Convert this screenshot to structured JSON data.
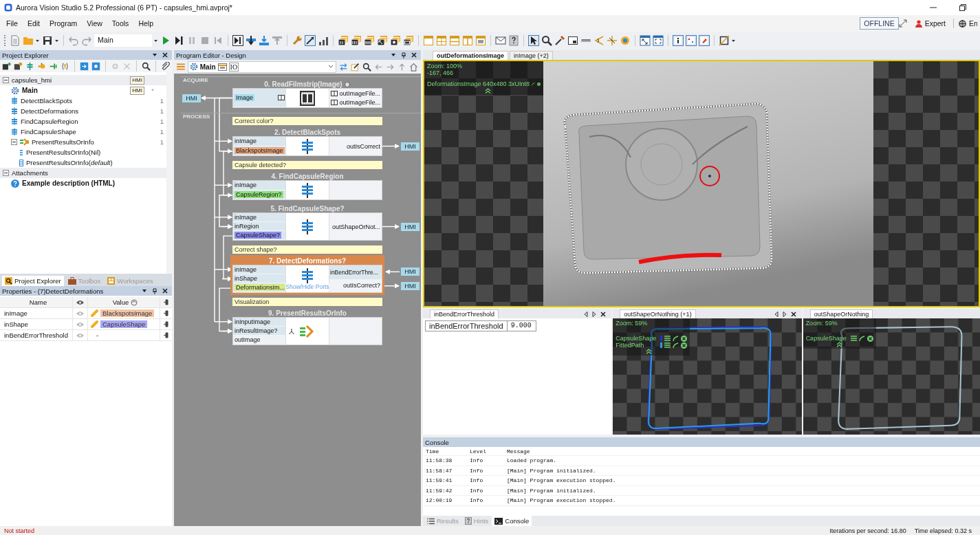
{
  "window": {
    "title": "Aurora Vision Studio 5.2 Professional (6 PT) - capsules_hmi.avproj*"
  },
  "menu": [
    "File",
    "Edit",
    "Program",
    "View",
    "Tools",
    "Help"
  ],
  "header_right": {
    "mode_button": "OFFLINE",
    "user": "Expert",
    "language": "En"
  },
  "toolbar": {
    "program_select": "Main"
  },
  "project_explorer": {
    "title": "Project Explorer",
    "tree": [
      {
        "label": "capsules_hmi",
        "expanded": true,
        "badge": "HMI",
        "children": [
          {
            "label": "Main",
            "kind": "main",
            "badge": "HMI",
            "mark": "*"
          },
          {
            "label": "DetectBlackSpots",
            "kind": "macro",
            "count": "1"
          },
          {
            "label": "DetectDeformations",
            "kind": "macro",
            "count": "1"
          },
          {
            "label": "FindCapsuleRegion",
            "kind": "macro",
            "count": "1"
          },
          {
            "label": "FindCapsuleShape",
            "kind": "macro",
            "count": "1"
          },
          {
            "label": "PresentResultsOrInfo",
            "kind": "variant",
            "count": "1",
            "expanded": true,
            "children": [
              {
                "label": "PresentResultsOrInfo(Nil)",
                "kind": "case-nil"
              },
              {
                "label": "PresentResultsOrInfo(*default*)",
                "kind": "case-default"
              }
            ]
          }
        ]
      },
      {
        "label": "Attachments",
        "expanded": true,
        "children": [
          {
            "label": "Example description (HTML)",
            "kind": "attachment"
          }
        ]
      }
    ]
  },
  "left_tabs": [
    {
      "label": "Project Explorer",
      "selected": true
    },
    {
      "label": "Toolbox",
      "selected": false
    },
    {
      "label": "Workspaces",
      "selected": false
    }
  ],
  "properties": {
    "title": "Properties - (7)DetectDeformations",
    "columns": {
      "name": "Name",
      "value": "Value"
    },
    "rows": [
      {
        "name": "inImage",
        "value": "BlackspotsImage",
        "color": "#f2c4a6"
      },
      {
        "name": "inShape",
        "value": "CapsuleShape",
        "color": "#aaa8f2"
      },
      {
        "name": "inBendErrorThreshold",
        "value": "-"
      }
    ]
  },
  "program_editor": {
    "title": "Program Editor - Design",
    "path": "Main",
    "io": "IO",
    "items": [
      {
        "kind": "section",
        "label": "ACQUIRE"
      },
      {
        "kind": "filmstrip",
        "title": "0. ReadFilmstrip(Image)",
        "selected": false,
        "hmi_in": "HMI",
        "inputs": [
          {
            "label": "Image",
            "kind": "tag",
            "color": "#a6dcea"
          }
        ],
        "outputs": [
          {
            "label": "outImageFile...",
            "kind": "output"
          },
          {
            "label": "outImageFile...",
            "kind": "output"
          }
        ]
      },
      {
        "kind": "section",
        "label": "PROCESS"
      },
      {
        "kind": "comment",
        "label": "Correct color?"
      },
      {
        "kind": "macro",
        "title": "2. DetectBlackSpots",
        "selected": false,
        "inputs": [
          {
            "label": "inImage",
            "kind": "port"
          },
          {
            "label": "BlackspotsImage",
            "kind": "tag",
            "color": "#e8a882"
          }
        ],
        "outputs": [
          {
            "label": "outIsCorrect",
            "kind": "output",
            "hmi": "HMI"
          }
        ]
      },
      {
        "kind": "comment",
        "label": "Capsule detected?"
      },
      {
        "kind": "macro",
        "title": "4. FindCapsuleRegion",
        "selected": false,
        "inputs": [
          {
            "label": "inImage",
            "kind": "port"
          },
          {
            "label": "CapsuleRegion?",
            "kind": "tag",
            "color": "#8ee07a"
          }
        ]
      },
      {
        "kind": "macro",
        "title": "5. FindCapsuleShape?",
        "selected": false,
        "inputs": [
          {
            "label": "inImage",
            "kind": "port"
          },
          {
            "label": "inRegion",
            "kind": "port"
          },
          {
            "label": "CapsuleShape?",
            "kind": "tag",
            "color": "#8f8cf0"
          }
        ],
        "outputs": [
          {
            "label": "outShapeOrNot...",
            "kind": "output",
            "hmi": "HMI"
          }
        ]
      },
      {
        "kind": "comment",
        "label": "Correct shape?"
      },
      {
        "kind": "macro",
        "title": "7. DetectDeformations?",
        "selected": true,
        "center_label": "Show/Hide Ports",
        "inputs": [
          {
            "label": "inImage",
            "kind": "port"
          },
          {
            "label": "inShape",
            "kind": "port"
          },
          {
            "label": "DeformationsIm...",
            "kind": "tag",
            "color": "#d6ea8a"
          }
        ],
        "outputs": [
          {
            "label": "inBendErrorThre...",
            "kind": "input",
            "hmi": "HMI"
          },
          {
            "label": "outIsCorrect?",
            "kind": "output",
            "hmi": "HMI"
          }
        ]
      },
      {
        "kind": "comment",
        "label": "Visualization"
      },
      {
        "kind": "variant",
        "title": "9. PresentResultsOrInfo",
        "selected": false,
        "inputs": [
          {
            "label": "inInputImage",
            "kind": "port"
          },
          {
            "label": "inResultImage?",
            "kind": "port"
          },
          {
            "label": "outImage",
            "kind": "output"
          }
        ]
      }
    ]
  },
  "image_view": {
    "tabs": [
      {
        "label": "outDeformationsImage",
        "selected": true
      },
      {
        "label": "inImage (+2)",
        "selected": false
      }
    ],
    "zoom": "Zoom: 100%",
    "coords": "-167, 466",
    "layer": "DeformationsImage 640x480 3xUInt8"
  },
  "bottom_panels": [
    {
      "kind": "parameter",
      "tab": "inBendErrorThreshold",
      "closable": true,
      "name": "inBendErrorThreshold",
      "value": "9.000"
    },
    {
      "kind": "shape",
      "tab": "outShapeOrNothing (+1)",
      "closable": true,
      "zoom": "Zoom: 59%",
      "layers": [
        {
          "label": "CapsuleShape",
          "color": "#2a2fd0"
        },
        {
          "label": "FittedPath",
          "color": "#2a9be0"
        }
      ]
    },
    {
      "kind": "shape",
      "tab": "outShapeOrNothing",
      "closable": false,
      "zoom": "Zoom: 59%",
      "layers": [
        {
          "label": "CapsuleShape"
        }
      ]
    }
  ],
  "console": {
    "title": "Console",
    "columns": [
      "Time",
      "Level",
      "Message"
    ],
    "rows": [
      {
        "time": "11:58:38",
        "level": "Info",
        "message": "Loaded program."
      },
      {
        "time": "11:58:47",
        "level": "Info",
        "message": "[Main] Program initialized."
      },
      {
        "time": "11:59:41",
        "level": "Info",
        "message": "[Main] Program execution stopped."
      },
      {
        "time": "11:59:42",
        "level": "Info",
        "message": "[Main] Program initialized."
      },
      {
        "time": "12:00:19",
        "level": "Info",
        "message": "[Main] Program execution stopped."
      }
    ]
  },
  "bottom_tabs": [
    {
      "label": "Results",
      "selected": false
    },
    {
      "label": "Hints",
      "selected": false
    },
    {
      "label": "Console",
      "selected": true
    }
  ],
  "status_bar": {
    "state": "Not started",
    "iterations": "Iterations per second: 16.80",
    "elapsed": "Time elapsed: 0.32 s"
  }
}
